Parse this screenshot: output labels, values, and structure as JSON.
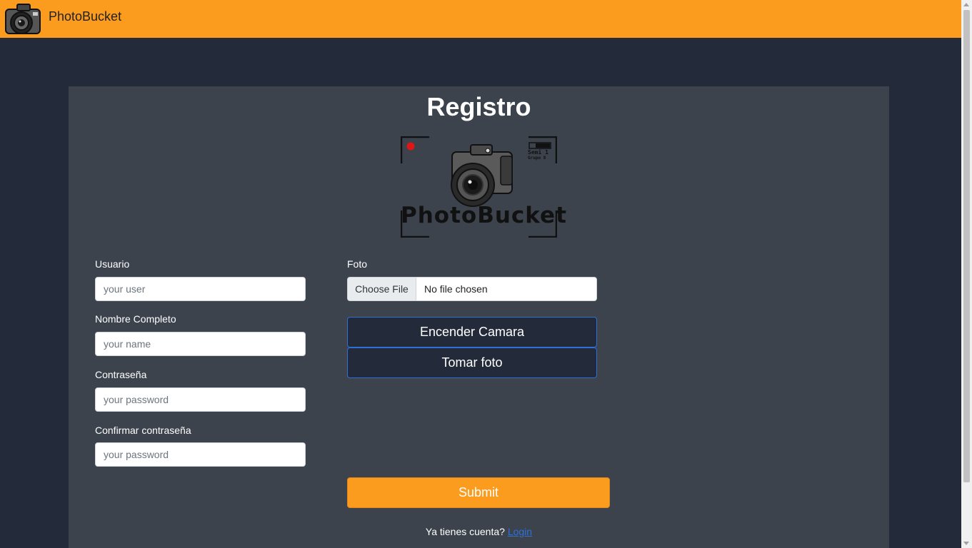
{
  "nav": {
    "brand": "PhotoBucket"
  },
  "page": {
    "title": "Registro"
  },
  "logo": {
    "text": "PhotoBucket",
    "tag_line1": "Semi 1",
    "tag_line2": "Grupo 8"
  },
  "form": {
    "usuario_label": "Usuario",
    "usuario_placeholder": "your user",
    "nombre_label": "Nombre Completo",
    "nombre_placeholder": "your name",
    "password_label": "Contraseña",
    "password_placeholder": "your password",
    "confirm_label": "Confirmar contraseña",
    "confirm_placeholder": "your password",
    "foto_label": "Foto",
    "choose_file_label": "Choose File",
    "file_status": "No file chosen",
    "camera_on_label": "Encender Camara",
    "take_photo_label": "Tomar foto",
    "submit_label": "Submit"
  },
  "footer": {
    "prompt": "Ya tienes cuenta?",
    "login_link": "Login"
  },
  "colors": {
    "accent": "#fb9c1e",
    "background": "#232a3a",
    "card": "#3c434d",
    "link": "#2f6fd6"
  },
  "icons": {
    "nav_logo": "camera-icon",
    "record_dot": "record-dot-icon",
    "battery": "battery-icon"
  }
}
